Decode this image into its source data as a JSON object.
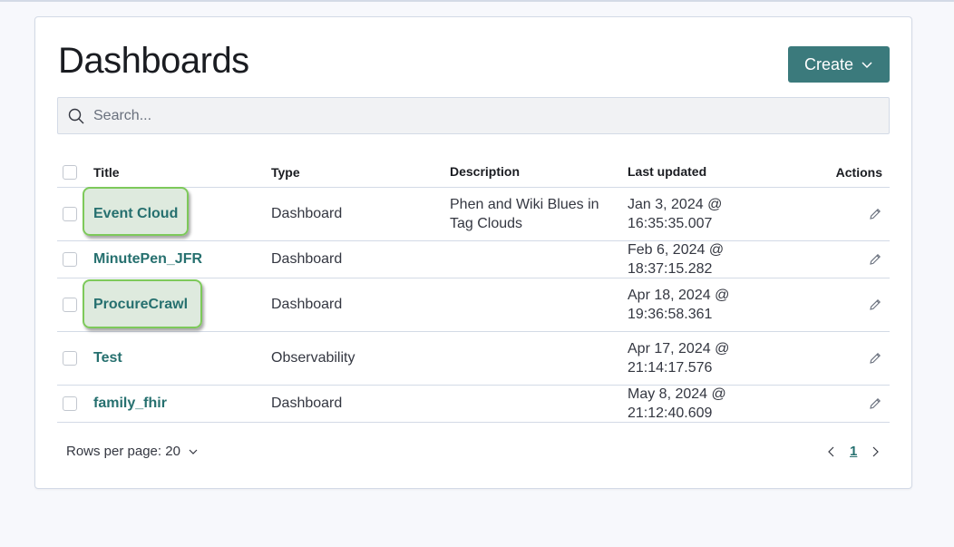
{
  "page": {
    "title": "Dashboards"
  },
  "create_button": {
    "label": "Create"
  },
  "search": {
    "placeholder": "Search..."
  },
  "table": {
    "headers": {
      "title": "Title",
      "type": "Type",
      "description": "Description",
      "last_updated": "Last updated",
      "actions": "Actions"
    },
    "rows": [
      {
        "title": "Event Cloud",
        "type": "Dashboard",
        "description": "Phen and Wiki Blues in Tag Clouds",
        "updated_1": "Jan 3, 2024 @ 16:35:35.007",
        "updated_2": ""
      },
      {
        "title": "MinutePen_JFR",
        "type": "Dashboard",
        "description": "",
        "updated_1": "Feb 6, 2024 @ 18:37:15.282",
        "updated_2": ""
      },
      {
        "title": "ProcureCrawl",
        "type": "Dashboard",
        "description": "",
        "updated_1": "Apr 18, 2024 @",
        "updated_2": "19:36:58.361"
      },
      {
        "title": "Test",
        "type": "Observability",
        "description": "",
        "updated_1": "Apr 17, 2024 @",
        "updated_2": "21:14:17.576"
      },
      {
        "title": "family_fhir",
        "type": "Dashboard",
        "description": "",
        "updated_1": "May 8, 2024 @ 21:12:40.609",
        "updated_2": ""
      }
    ]
  },
  "footer": {
    "rows_per_page": "Rows per page: 20",
    "current_page": "1"
  },
  "colors": {
    "accent": "#3b7a7c",
    "link": "#26706f",
    "highlight_border": "#7dc95a"
  }
}
